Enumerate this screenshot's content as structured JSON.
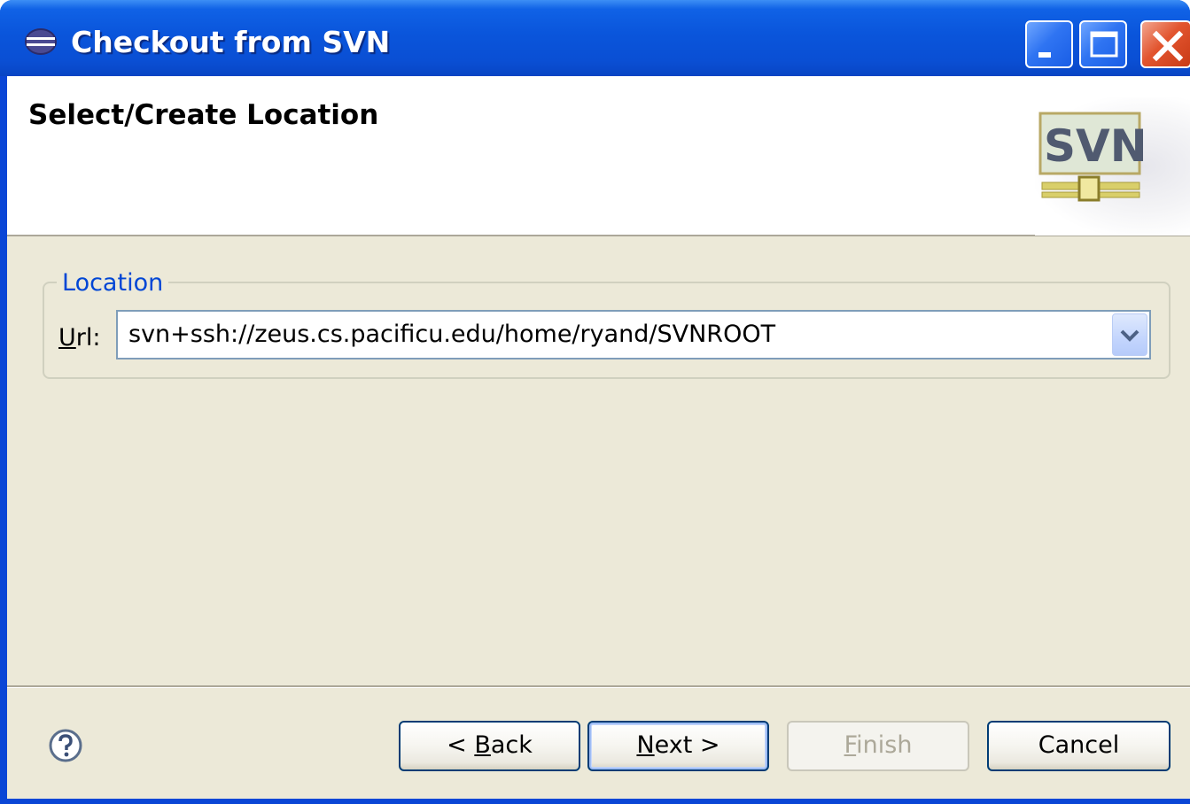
{
  "window": {
    "title": "Checkout from SVN",
    "controls": {
      "minimize": "minimize",
      "maximize": "maximize",
      "close": "close"
    }
  },
  "header": {
    "title": "Select/Create Location",
    "logo_text": "SVN"
  },
  "location_group": {
    "legend": "Location",
    "url_label_mnemonic": "U",
    "url_label_rest": "rl:",
    "url_value": "svn+ssh://zeus.cs.pacificu.edu/home/ryand/SVNROOT"
  },
  "buttons": {
    "back_prefix": "< ",
    "back_mnemonic": "B",
    "back_rest": "ack",
    "next_mnemonic": "N",
    "next_rest": "ext >",
    "finish_mnemonic": "F",
    "finish_rest": "inish",
    "cancel": "Cancel"
  },
  "colors": {
    "titlebar": "#0a55db",
    "dialog_bg": "#ece9d8",
    "legend_text": "#0046d5",
    "button_border": "#003c74"
  }
}
